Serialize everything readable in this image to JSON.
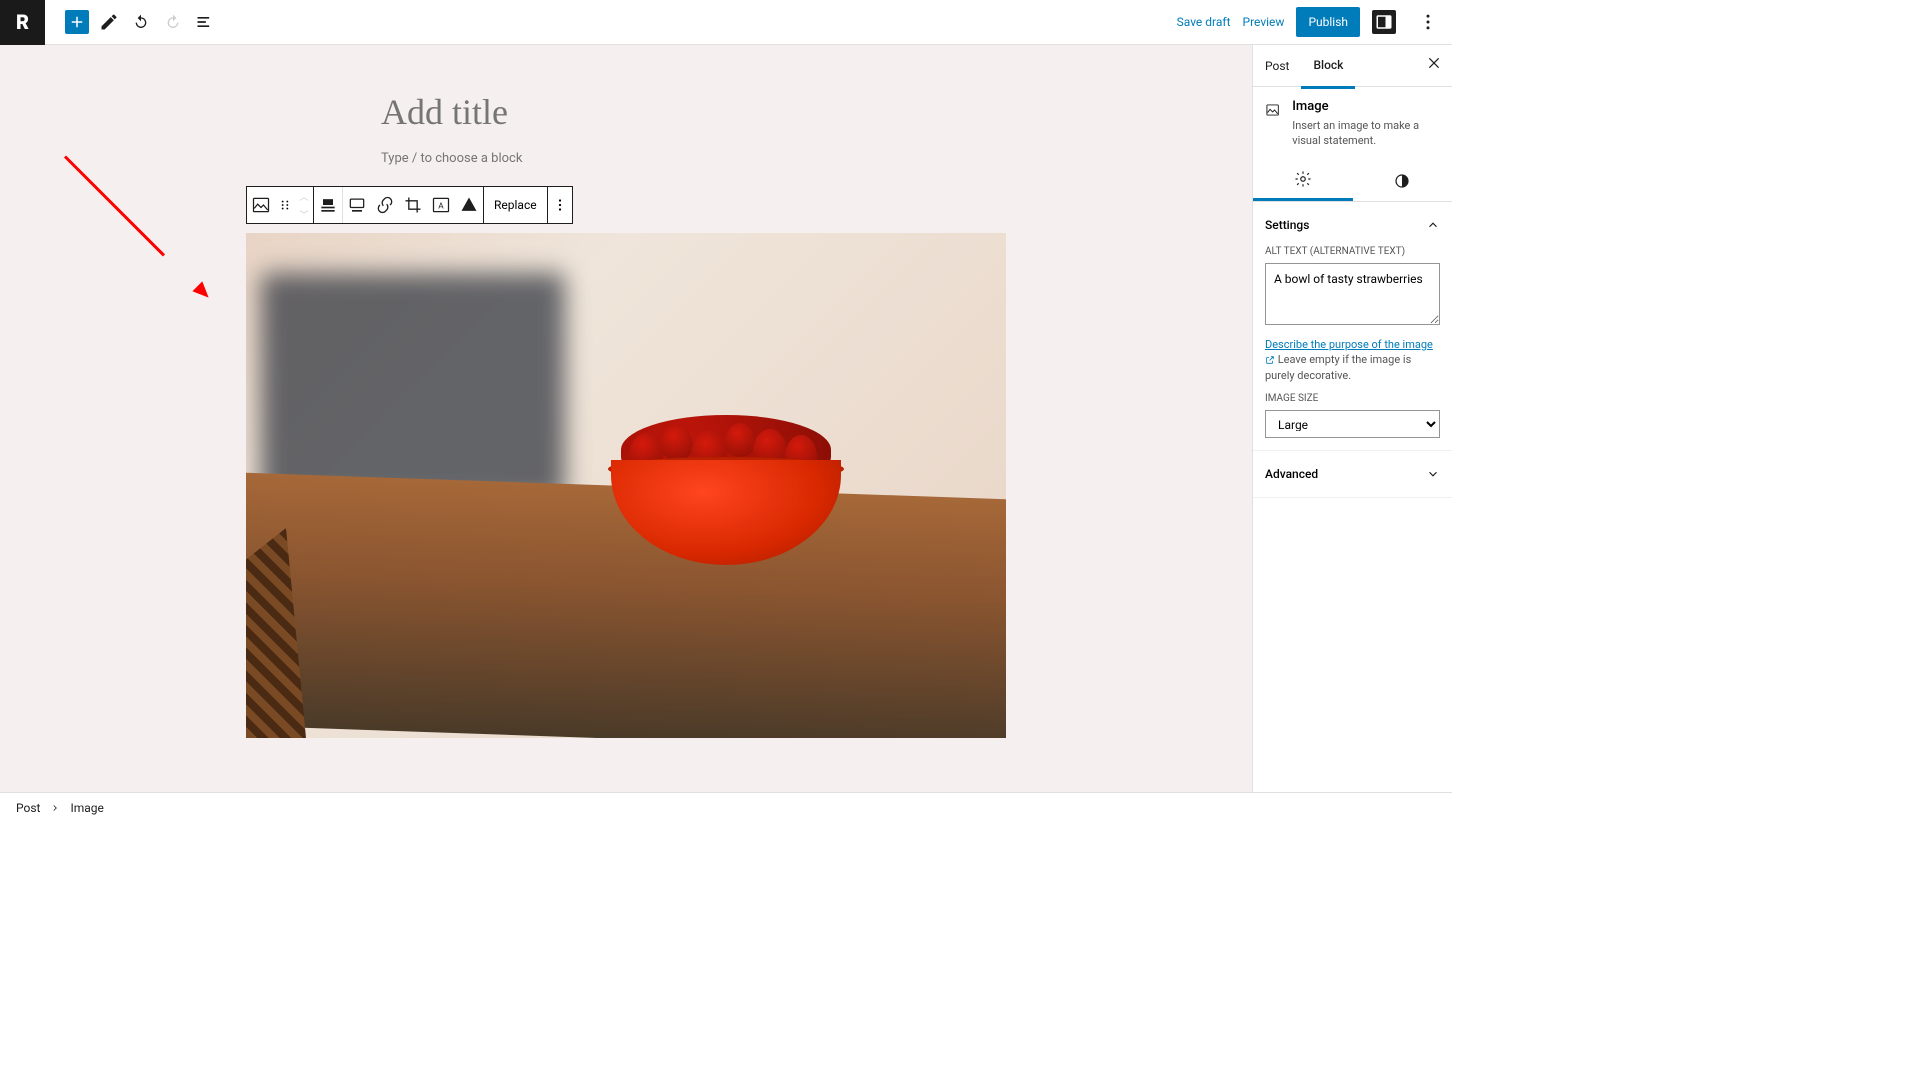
{
  "topbar": {
    "logo": "R",
    "save_draft": "Save draft",
    "preview": "Preview",
    "publish": "Publish"
  },
  "editor": {
    "title_placeholder": "Add title",
    "block_hint": "Type / to choose a block",
    "toolbar": {
      "replace": "Replace"
    }
  },
  "sidebar": {
    "tabs": {
      "post": "Post",
      "block": "Block"
    },
    "block": {
      "name": "Image",
      "description": "Insert an image to make a visual statement."
    },
    "settings": {
      "heading": "Settings",
      "alt_label": "ALT TEXT (ALTERNATIVE TEXT)",
      "alt_value": "A bowl of tasty strawberries",
      "help_link": "Describe the purpose of the image",
      "help_rest": "Leave empty if the image is purely decorative.",
      "size_label": "IMAGE SIZE",
      "size_value": "Large"
    },
    "advanced": "Advanced"
  },
  "footer": {
    "crumb1": "Post",
    "crumb2": "Image"
  }
}
